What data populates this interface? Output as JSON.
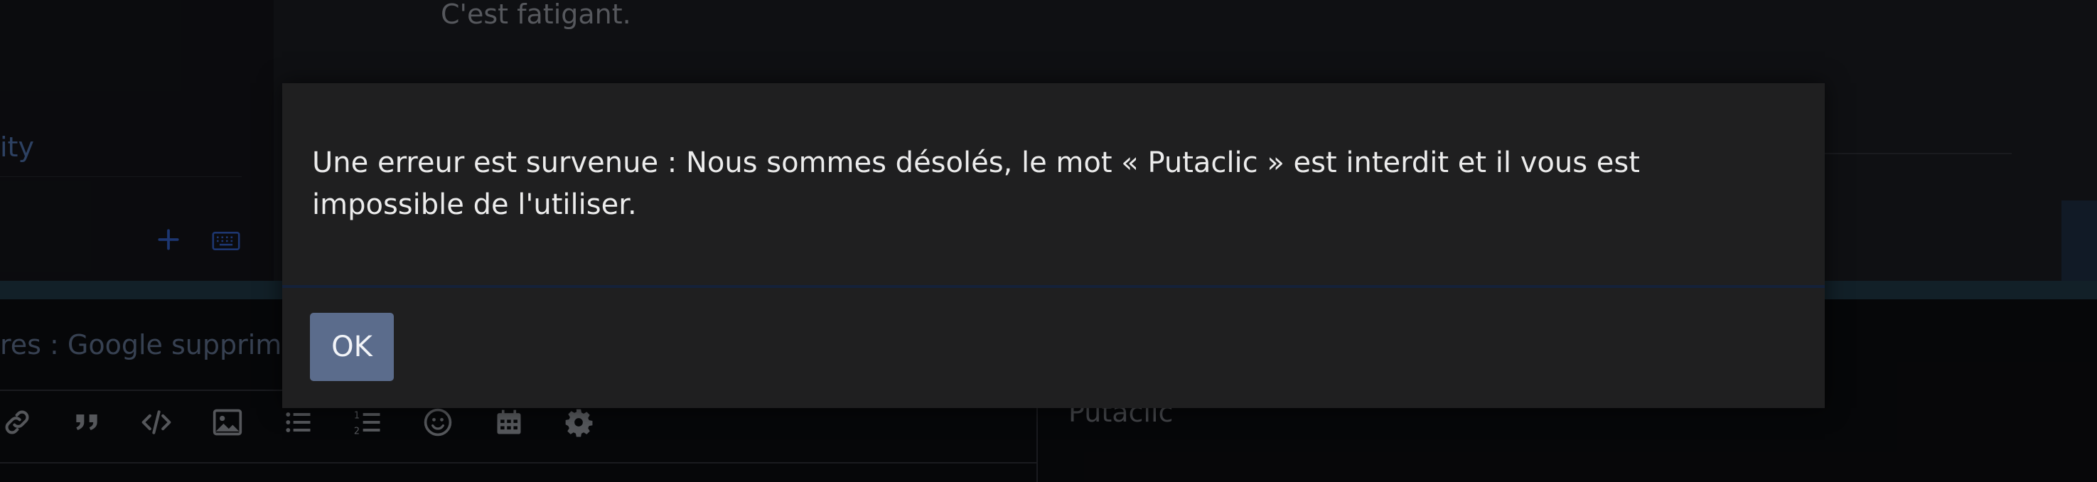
{
  "background": {
    "post_text": "C'est fatigant.",
    "sidebar_link_text": "ity",
    "editor_input_text": "res : Google supprim",
    "preview_text": "Putaclic",
    "toolbar_icons": [
      "link-icon",
      "quote-icon",
      "code-icon",
      "image-icon",
      "bulleted-list-icon",
      "numbered-list-icon",
      "emoji-icon",
      "calendar-icon",
      "settings-icon"
    ]
  },
  "dialog": {
    "message": "Une erreur est survenue : Nous sommes désolés, le mot « Putaclic » est interdit et il vous est impossible de l'utiliser.",
    "ok_label": "OK"
  },
  "colors": {
    "ok_button": "#5b6c8c",
    "dialog_background": "#1f1f20",
    "accent_blue": "#2f57b5"
  }
}
